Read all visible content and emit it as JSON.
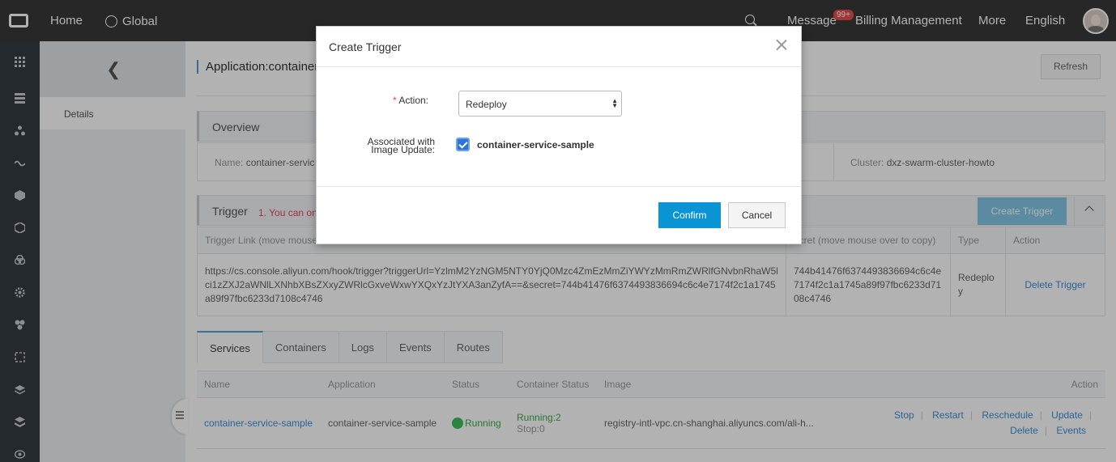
{
  "topbar": {
    "home": "Home",
    "global": "Global",
    "message": "Message",
    "message_badge": "99+",
    "billing": "Billing Management",
    "more": "More",
    "language": "English"
  },
  "sidebar": {
    "back_icon": "chevron-left-icon",
    "details": "Details"
  },
  "header": {
    "title": "Application:container",
    "refresh": "Refresh"
  },
  "overview": {
    "title": "Overview",
    "name_label": "Name:",
    "name_value": "container-servic",
    "cluster_label": "Cluster:",
    "cluster_value": "dxz-swarm-cluster-howto"
  },
  "trigger": {
    "title": "Trigger",
    "note": "1. You can on",
    "create": "Create Trigger",
    "columns": [
      "Trigger Link (move mouse",
      "ecret (move mouse over to copy)",
      "Type",
      "Action"
    ],
    "row": {
      "link": "https://cs.console.aliyun.com/hook/trigger?triggerUrl=YzlmM2YzNGM5NTY0YjQ0Mzc4ZmEzMmZiYWYzMmRmZWRlfGNvbnRhaW5lci1zZXJ2aWNlLXNhbXBsZXxyZWRlcGxveWxwYXQxYzJtYXA3anZyfA==&secret=744b41476f6374493836694c6c4e7174f2c1a1745a89f97fbc6233d7108c4746",
      "secret": "744b41476f6374493836694c6c4e7174f2c1a1745a89f97fbc6233d7108c4746",
      "type": "Redeploy",
      "action": "Delete Trigger"
    }
  },
  "tabs": [
    "Services",
    "Containers",
    "Logs",
    "Events",
    "Routes"
  ],
  "services": {
    "columns": [
      "Name",
      "Application",
      "Status",
      "Container Status",
      "Image",
      "Action"
    ],
    "row": {
      "name": "container-service-sample",
      "application": "container-service-sample",
      "status": "Running",
      "container_running": "Running:2",
      "container_stop": "Stop:0",
      "image": "registry-intl-vpc.cn-shanghai.aliyuncs.com/ali-h...",
      "actions": [
        "Stop",
        "Restart",
        "Reschedule",
        "Update",
        "Delete",
        "Events"
      ]
    }
  },
  "modal": {
    "title": "Create Trigger",
    "required_mark": "*",
    "action_label": "Action:",
    "action_value": "Redeploy",
    "assoc_label_1": "Associated with",
    "assoc_label_2": "Image Update:",
    "service_checked": true,
    "service_name": "container-service-sample",
    "confirm": "Confirm",
    "cancel": "Cancel"
  },
  "colors": {
    "topbar": "#393939",
    "rail": "#333b41",
    "primary": "#0a94d3",
    "link": "#3d8fd6",
    "running": "#3fbf5a",
    "note": "#e6455d"
  }
}
